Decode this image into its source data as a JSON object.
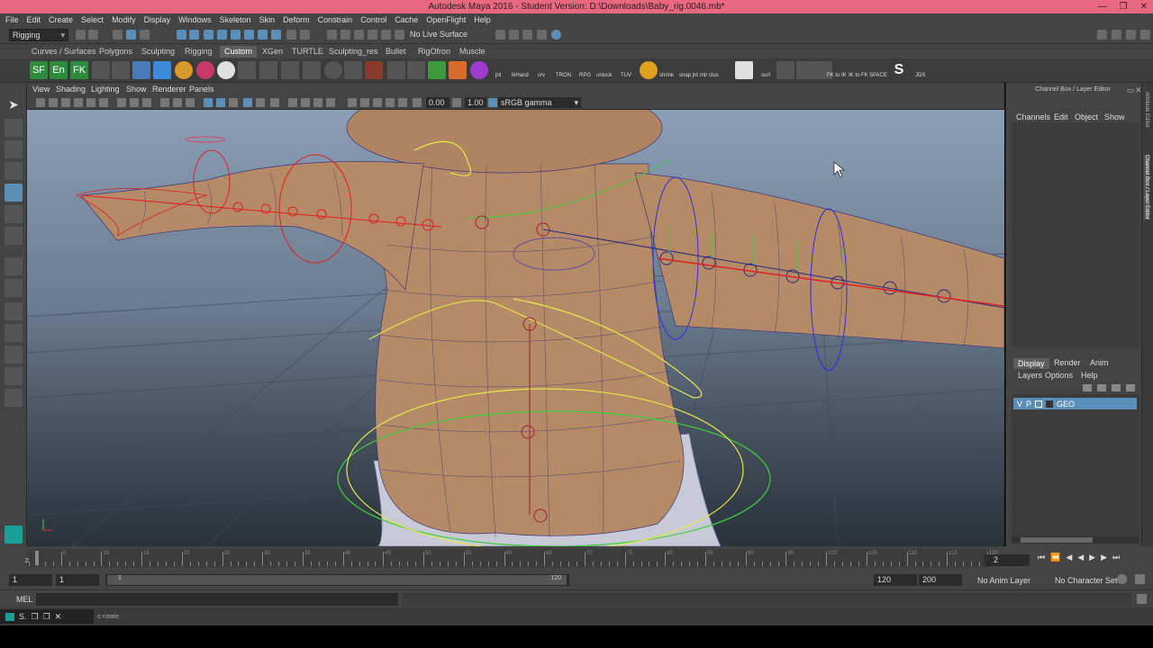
{
  "window": {
    "title": "Autodesk Maya 2016 - Student Version: D:\\Downloads\\Baby_rig.0046.mb*"
  },
  "menus": [
    "File",
    "Edit",
    "Create",
    "Select",
    "Modify",
    "Display",
    "Windows",
    "Skeleton",
    "Skin",
    "Deform",
    "Constrain",
    "Control",
    "Cache",
    "OpenFlight",
    "Help"
  ],
  "status_line": {
    "mode": "Rigging",
    "live_surface": "No Live Surface"
  },
  "shelf_tabs": [
    "Curves / Surfaces",
    "Polygons",
    "Sculpting",
    "Rigging",
    "Custom",
    "XGen",
    "TURTLE",
    "Sculpting_res",
    "Bullet",
    "RigOfron",
    "Muscle"
  ],
  "active_shelf_tab": "Custom",
  "shelf_labels": [
    "jnt",
    "ikHand",
    "crv",
    "TRON",
    "RPG",
    "unlock",
    "TUV",
    "shrink",
    "snap jnt",
    "mir clus",
    "surf",
    "FK to IK",
    "IK to FK",
    "SPACE",
    "JDS"
  ],
  "shelf_letters": {
    "s1": "SF",
    "s2": "En",
    "s3": "FK",
    "s4": "S"
  },
  "viewport": {
    "menus": [
      "View",
      "Shading",
      "Lighting",
      "Show",
      "Renderer",
      "Panels"
    ],
    "field_1": "0.00",
    "field_2": "1.00",
    "color_space": "sRGB gamma"
  },
  "channel_box": {
    "title": "Channel Box / Layer Editor",
    "menus": [
      "Channels",
      "Edit",
      "Object",
      "Show"
    ],
    "side_tabs": [
      "Attribute Editor",
      "Channel Box / Layer Editor"
    ],
    "layer_tabs": [
      "Display",
      "Render",
      "Anim"
    ],
    "active_layer_tab": "Display",
    "layer_menus": [
      "Layers",
      "Options",
      "Help"
    ],
    "layer": {
      "v": "V",
      "p": "P",
      "name": "GEO"
    }
  },
  "time_slider": {
    "ticks": [
      "5",
      "10",
      "15",
      "20",
      "25",
      "30",
      "35",
      "40",
      "45",
      "50",
      "55",
      "60",
      "65",
      "70",
      "75",
      "80",
      "85",
      "90",
      "95",
      "100",
      "105",
      "110",
      "115",
      "120"
    ],
    "current_frame_marker": "2",
    "current_frame": "2"
  },
  "range_slider": {
    "start": "1",
    "anim_start": "1",
    "range_start_label": "1",
    "range_end_label": "120",
    "anim_end": "120",
    "end": "200",
    "anim_layer": "No Anim Layer",
    "character_set": "No Character Set"
  },
  "command_line": {
    "label": "MEL"
  },
  "help_line": {
    "text": "o rotate."
  },
  "colors": {
    "title_bar": "#e8687f",
    "ui_bg": "#444444",
    "selection": "#5c8fb8",
    "joint_red": "#e02020",
    "curve_yellow": "#e6e64a",
    "curve_green": "#3fcf3f",
    "curve_blue": "#3030e0",
    "skin": "#b58a66"
  }
}
